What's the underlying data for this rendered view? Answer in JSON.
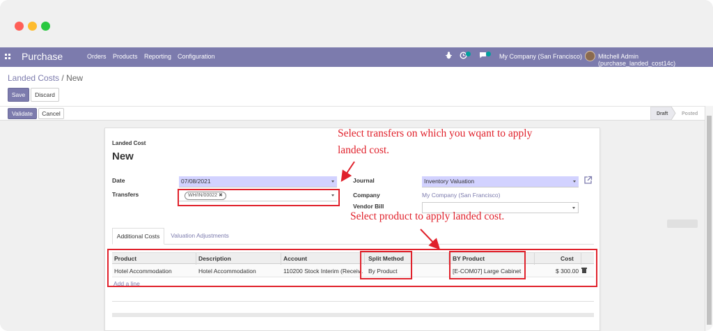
{
  "navbar": {
    "app_title": "Purchase",
    "menu": [
      "Orders",
      "Products",
      "Reporting",
      "Configuration"
    ],
    "activity_count": "6",
    "message_count": "5",
    "company": "My Company (San Francisco)",
    "user": "Mitchell Admin (purchase_landed_cost14c)"
  },
  "breadcrumb": {
    "parent": "Landed Costs",
    "sep": "/",
    "current": "New"
  },
  "control": {
    "save": "Save",
    "discard": "Discard"
  },
  "status": {
    "validate": "Validate",
    "cancel": "Cancel",
    "stages": [
      "Draft",
      "Posted"
    ],
    "active_stage": "Draft"
  },
  "form": {
    "model_label": "Landed Cost",
    "name": "New",
    "date_label": "Date",
    "date_value": "07/08/2021",
    "transfers_label": "Transfers",
    "transfer_tag": "WH/IN/00022",
    "journal_label": "Journal",
    "journal_value": "Inventory Valuation",
    "company_label": "Company",
    "company_value": "My Company (San Francisco)",
    "vendor_bill_label": "Vendor Bill",
    "vendor_bill_value": ""
  },
  "tabs": [
    "Additional Costs",
    "Valuation Adjustments"
  ],
  "cost_table": {
    "headers": [
      "Product",
      "Description",
      "Account",
      "Split Method",
      "BY Product",
      "Cost"
    ],
    "rows": [
      [
        "Hotel Accommodation",
        "Hotel Accommodation",
        "110200 Stock Interim (Receiv...",
        "By Product",
        "[E-COM07] Large Cabinet",
        "$ 300.00"
      ]
    ],
    "add_line": "Add a line"
  },
  "annotations": {
    "transfers_line1": "Select transfers on which you wqant to apply",
    "transfers_line2": "landed cost.",
    "product": "Select product to apply landed cost."
  },
  "colors": {
    "brand": "#7c7bad",
    "annotation_red": "#e0212b",
    "required_field": "#d2d2ff",
    "mac_close": "#ff5f57",
    "mac_min": "#febc2e",
    "mac_max": "#28c840"
  },
  "icons": [
    "apps-grid-icon",
    "bug-icon",
    "clock-icon",
    "chat-icon",
    "external-link-icon",
    "trash-icon",
    "remove-tag-icon"
  ]
}
